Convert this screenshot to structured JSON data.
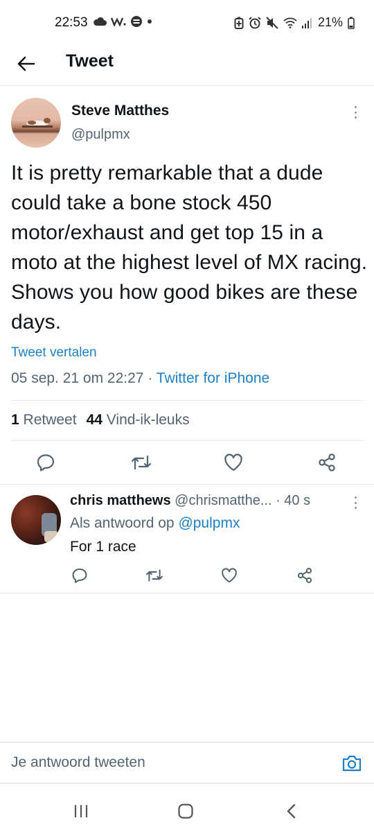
{
  "status_bar": {
    "time": "22:53",
    "battery": "21%",
    "icons_left": [
      "cloud-icon",
      "w-app-icon",
      "message-icon",
      "dot-icon"
    ],
    "icons_right": [
      "battery-saver-icon",
      "alarm-icon",
      "mute-icon",
      "wifi-icon",
      "signal-icon",
      "battery-icon"
    ]
  },
  "header": {
    "title": "Tweet"
  },
  "tweet": {
    "author_name": "Steve Matthes",
    "author_handle": "@pulpmx",
    "text": "It is pretty remarkable that a dude could take a bone stock 450 motor/exhaust and get top 15 in a moto at the highest level of MX racing. Shows you how good bikes are these days.",
    "translate_label": "Tweet vertalen",
    "date": "05 sep. 21 om 22:27",
    "separator": " · ",
    "source": "Twitter for iPhone",
    "retweets_count": "1",
    "retweets_label": "Retweet",
    "likes_count": "44",
    "likes_label": "Vind-ik-leuks"
  },
  "reply": {
    "name": "chris matthews",
    "handle": "@chrismatthe...",
    "time": "· 40 s",
    "reply_prefix": "Als antwoord op",
    "reply_mention": "@pulpmx",
    "text": "For 1 race"
  },
  "composer": {
    "placeholder": "Je antwoord tweeten"
  },
  "colors": {
    "link": "#1d7fc4",
    "secondary_text": "#536471",
    "primary_text": "#0f1419",
    "divider": "#e6e6e6"
  }
}
